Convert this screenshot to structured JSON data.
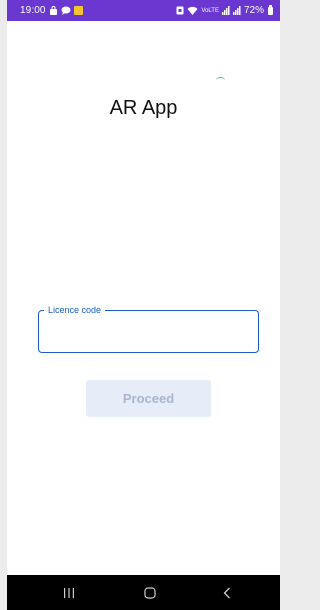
{
  "status_bar": {
    "time": "19:00",
    "network_label": "VoLTE",
    "battery": "72%",
    "notification_icons": [
      "shopping-bag-icon",
      "chat-bubble-icon",
      "notification-icon"
    ],
    "status_icons": [
      "nfc-icon",
      "wifi-icon",
      "signal-icon",
      "signal-icon",
      "battery-icon"
    ]
  },
  "app": {
    "title": "AR App"
  },
  "form": {
    "licence_label": "Licence code",
    "licence_value": "",
    "proceed_label": "Proceed"
  },
  "navigation": {
    "buttons": [
      "recent-apps-icon",
      "home-icon",
      "back-icon"
    ]
  },
  "colors": {
    "status_bar": "#6a38d0",
    "field_accent": "#1a5bc4",
    "button_bg_disabled": "#e6edf9",
    "button_text_disabled": "#a7b6cc",
    "nav_bar": "#000000"
  }
}
